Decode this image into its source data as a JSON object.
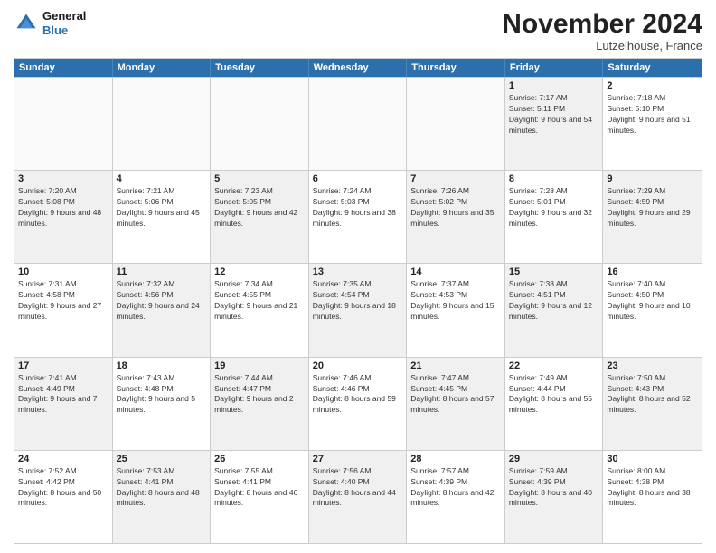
{
  "logo": {
    "line1": "General",
    "line2": "Blue"
  },
  "title": "November 2024",
  "location": "Lutzelhouse, France",
  "header_days": [
    "Sunday",
    "Monday",
    "Tuesday",
    "Wednesday",
    "Thursday",
    "Friday",
    "Saturday"
  ],
  "rows": [
    [
      {
        "day": "",
        "info": "",
        "shaded": false,
        "empty": true
      },
      {
        "day": "",
        "info": "",
        "shaded": false,
        "empty": true
      },
      {
        "day": "",
        "info": "",
        "shaded": false,
        "empty": true
      },
      {
        "day": "",
        "info": "",
        "shaded": false,
        "empty": true
      },
      {
        "day": "",
        "info": "",
        "shaded": false,
        "empty": true
      },
      {
        "day": "1",
        "info": "Sunrise: 7:17 AM\nSunset: 5:11 PM\nDaylight: 9 hours and 54 minutes.",
        "shaded": true,
        "empty": false
      },
      {
        "day": "2",
        "info": "Sunrise: 7:18 AM\nSunset: 5:10 PM\nDaylight: 9 hours and 51 minutes.",
        "shaded": false,
        "empty": false
      }
    ],
    [
      {
        "day": "3",
        "info": "Sunrise: 7:20 AM\nSunset: 5:08 PM\nDaylight: 9 hours and 48 minutes.",
        "shaded": true,
        "empty": false
      },
      {
        "day": "4",
        "info": "Sunrise: 7:21 AM\nSunset: 5:06 PM\nDaylight: 9 hours and 45 minutes.",
        "shaded": false,
        "empty": false
      },
      {
        "day": "5",
        "info": "Sunrise: 7:23 AM\nSunset: 5:05 PM\nDaylight: 9 hours and 42 minutes.",
        "shaded": true,
        "empty": false
      },
      {
        "day": "6",
        "info": "Sunrise: 7:24 AM\nSunset: 5:03 PM\nDaylight: 9 hours and 38 minutes.",
        "shaded": false,
        "empty": false
      },
      {
        "day": "7",
        "info": "Sunrise: 7:26 AM\nSunset: 5:02 PM\nDaylight: 9 hours and 35 minutes.",
        "shaded": true,
        "empty": false
      },
      {
        "day": "8",
        "info": "Sunrise: 7:28 AM\nSunset: 5:01 PM\nDaylight: 9 hours and 32 minutes.",
        "shaded": false,
        "empty": false
      },
      {
        "day": "9",
        "info": "Sunrise: 7:29 AM\nSunset: 4:59 PM\nDaylight: 9 hours and 29 minutes.",
        "shaded": true,
        "empty": false
      }
    ],
    [
      {
        "day": "10",
        "info": "Sunrise: 7:31 AM\nSunset: 4:58 PM\nDaylight: 9 hours and 27 minutes.",
        "shaded": false,
        "empty": false
      },
      {
        "day": "11",
        "info": "Sunrise: 7:32 AM\nSunset: 4:56 PM\nDaylight: 9 hours and 24 minutes.",
        "shaded": true,
        "empty": false
      },
      {
        "day": "12",
        "info": "Sunrise: 7:34 AM\nSunset: 4:55 PM\nDaylight: 9 hours and 21 minutes.",
        "shaded": false,
        "empty": false
      },
      {
        "day": "13",
        "info": "Sunrise: 7:35 AM\nSunset: 4:54 PM\nDaylight: 9 hours and 18 minutes.",
        "shaded": true,
        "empty": false
      },
      {
        "day": "14",
        "info": "Sunrise: 7:37 AM\nSunset: 4:53 PM\nDaylight: 9 hours and 15 minutes.",
        "shaded": false,
        "empty": false
      },
      {
        "day": "15",
        "info": "Sunrise: 7:38 AM\nSunset: 4:51 PM\nDaylight: 9 hours and 12 minutes.",
        "shaded": true,
        "empty": false
      },
      {
        "day": "16",
        "info": "Sunrise: 7:40 AM\nSunset: 4:50 PM\nDaylight: 9 hours and 10 minutes.",
        "shaded": false,
        "empty": false
      }
    ],
    [
      {
        "day": "17",
        "info": "Sunrise: 7:41 AM\nSunset: 4:49 PM\nDaylight: 9 hours and 7 minutes.",
        "shaded": true,
        "empty": false
      },
      {
        "day": "18",
        "info": "Sunrise: 7:43 AM\nSunset: 4:48 PM\nDaylight: 9 hours and 5 minutes.",
        "shaded": false,
        "empty": false
      },
      {
        "day": "19",
        "info": "Sunrise: 7:44 AM\nSunset: 4:47 PM\nDaylight: 9 hours and 2 minutes.",
        "shaded": true,
        "empty": false
      },
      {
        "day": "20",
        "info": "Sunrise: 7:46 AM\nSunset: 4:46 PM\nDaylight: 8 hours and 59 minutes.",
        "shaded": false,
        "empty": false
      },
      {
        "day": "21",
        "info": "Sunrise: 7:47 AM\nSunset: 4:45 PM\nDaylight: 8 hours and 57 minutes.",
        "shaded": true,
        "empty": false
      },
      {
        "day": "22",
        "info": "Sunrise: 7:49 AM\nSunset: 4:44 PM\nDaylight: 8 hours and 55 minutes.",
        "shaded": false,
        "empty": false
      },
      {
        "day": "23",
        "info": "Sunrise: 7:50 AM\nSunset: 4:43 PM\nDaylight: 8 hours and 52 minutes.",
        "shaded": true,
        "empty": false
      }
    ],
    [
      {
        "day": "24",
        "info": "Sunrise: 7:52 AM\nSunset: 4:42 PM\nDaylight: 8 hours and 50 minutes.",
        "shaded": false,
        "empty": false
      },
      {
        "day": "25",
        "info": "Sunrise: 7:53 AM\nSunset: 4:41 PM\nDaylight: 8 hours and 48 minutes.",
        "shaded": true,
        "empty": false
      },
      {
        "day": "26",
        "info": "Sunrise: 7:55 AM\nSunset: 4:41 PM\nDaylight: 8 hours and 46 minutes.",
        "shaded": false,
        "empty": false
      },
      {
        "day": "27",
        "info": "Sunrise: 7:56 AM\nSunset: 4:40 PM\nDaylight: 8 hours and 44 minutes.",
        "shaded": true,
        "empty": false
      },
      {
        "day": "28",
        "info": "Sunrise: 7:57 AM\nSunset: 4:39 PM\nDaylight: 8 hours and 42 minutes.",
        "shaded": false,
        "empty": false
      },
      {
        "day": "29",
        "info": "Sunrise: 7:59 AM\nSunset: 4:39 PM\nDaylight: 8 hours and 40 minutes.",
        "shaded": true,
        "empty": false
      },
      {
        "day": "30",
        "info": "Sunrise: 8:00 AM\nSunset: 4:38 PM\nDaylight: 8 hours and 38 minutes.",
        "shaded": false,
        "empty": false
      }
    ]
  ]
}
